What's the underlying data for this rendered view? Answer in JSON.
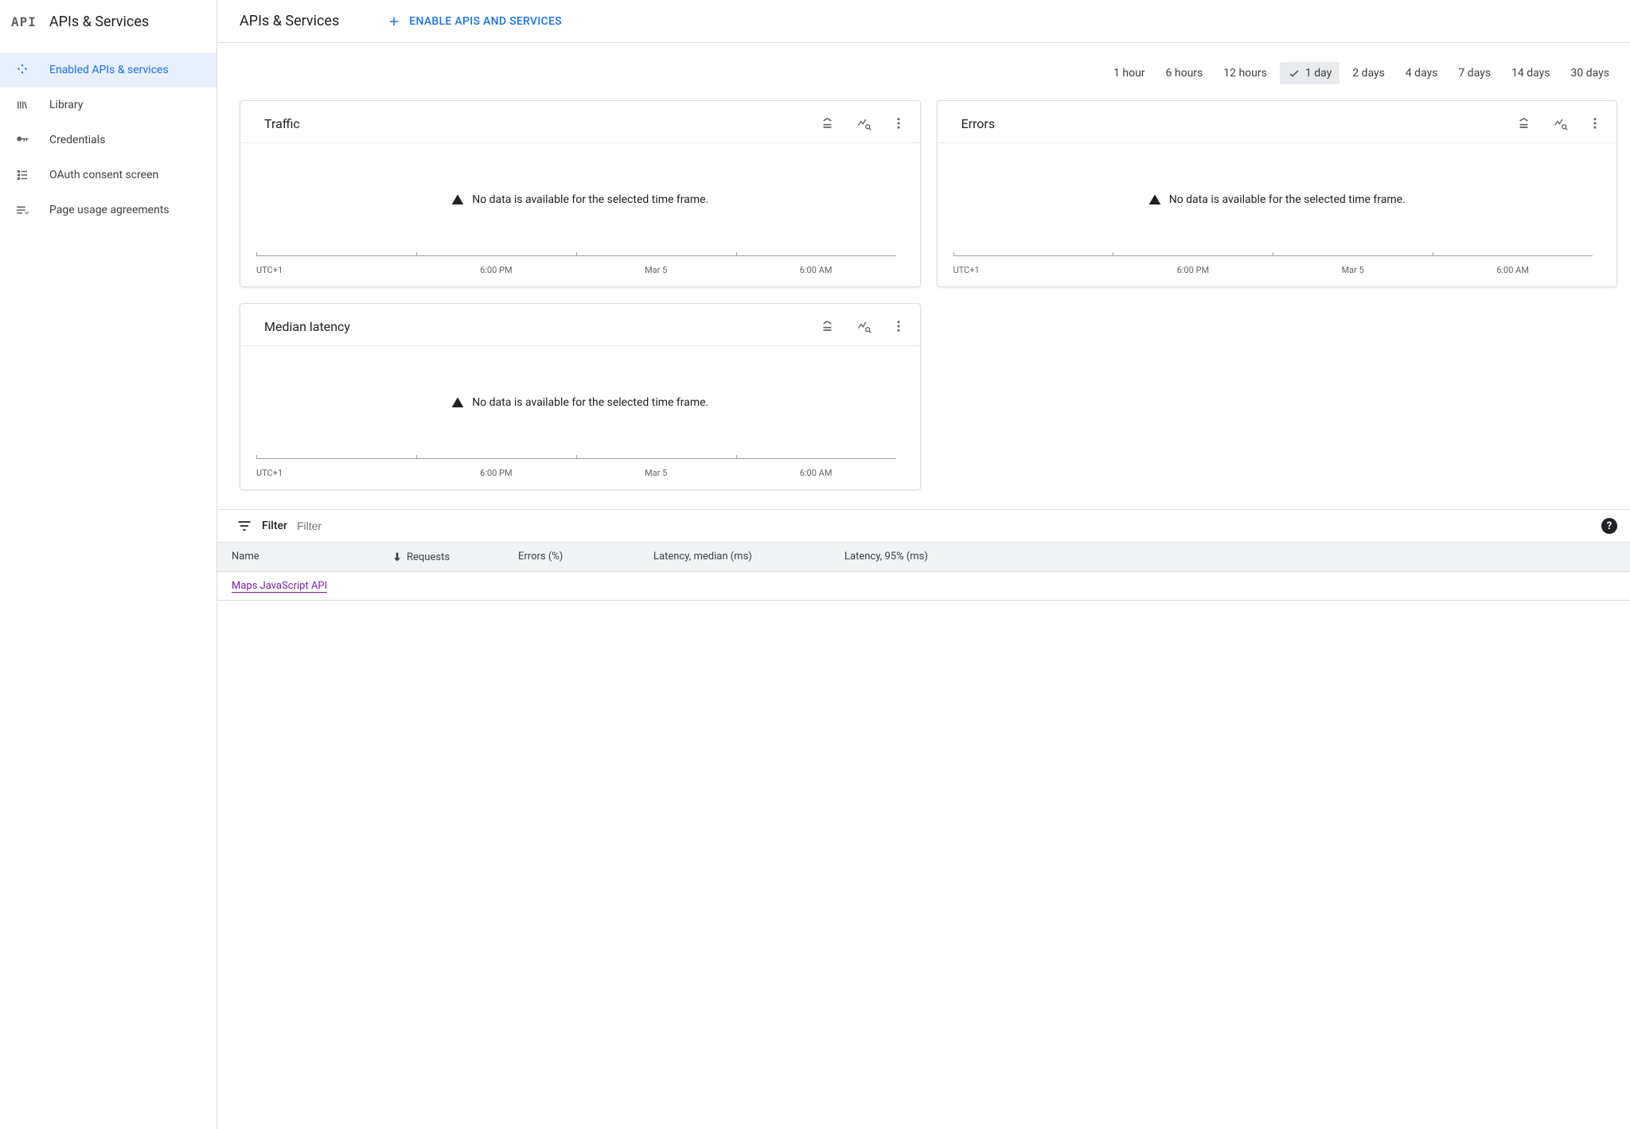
{
  "sidebar": {
    "logo": "API",
    "title": "APIs & Services",
    "items": [
      {
        "label": "Enabled APIs & services",
        "active": true
      },
      {
        "label": "Library",
        "active": false
      },
      {
        "label": "Credentials",
        "active": false
      },
      {
        "label": "OAuth consent screen",
        "active": false
      },
      {
        "label": "Page usage agreements",
        "active": false
      }
    ]
  },
  "header": {
    "title": "APIs & Services",
    "enable_label": "ENABLE APIS AND SERVICES"
  },
  "time_ranges": [
    "1 hour",
    "6 hours",
    "12 hours",
    "1 day",
    "2 days",
    "4 days",
    "7 days",
    "14 days",
    "30 days"
  ],
  "time_selected": "1 day",
  "cards": {
    "traffic": {
      "title": "Traffic",
      "nodata": "No data is available for the selected time frame."
    },
    "errors": {
      "title": "Errors",
      "nodata": "No data is available for the selected time frame."
    },
    "latency": {
      "title": "Median latency",
      "nodata": "No data is available for the selected time frame."
    },
    "axis_labels": [
      "UTC+1",
      "6:00 PM",
      "Mar 5",
      "6:00 AM"
    ]
  },
  "filter": {
    "label": "Filter",
    "placeholder": "Filter"
  },
  "table": {
    "headers": {
      "name": "Name",
      "requests": "Requests",
      "errors": "Errors (%)",
      "latency_median": "Latency, median (ms)",
      "latency_p95": "Latency, 95% (ms)"
    },
    "rows": [
      {
        "name": "Maps JavaScript API"
      }
    ]
  },
  "chart_data": [
    {
      "type": "line",
      "title": "Traffic",
      "x": [],
      "series": [],
      "xlabel": "",
      "ylabel": "",
      "note": "No data is available for the selected time frame.",
      "x_ticks": [
        "UTC+1",
        "6:00 PM",
        "Mar 5",
        "6:00 AM"
      ]
    },
    {
      "type": "line",
      "title": "Errors",
      "x": [],
      "series": [],
      "xlabel": "",
      "ylabel": "",
      "note": "No data is available for the selected time frame.",
      "x_ticks": [
        "UTC+1",
        "6:00 PM",
        "Mar 5",
        "6:00 AM"
      ]
    },
    {
      "type": "line",
      "title": "Median latency",
      "x": [],
      "series": [],
      "xlabel": "",
      "ylabel": "",
      "note": "No data is available for the selected time frame.",
      "x_ticks": [
        "UTC+1",
        "6:00 PM",
        "Mar 5",
        "6:00 AM"
      ]
    }
  ]
}
